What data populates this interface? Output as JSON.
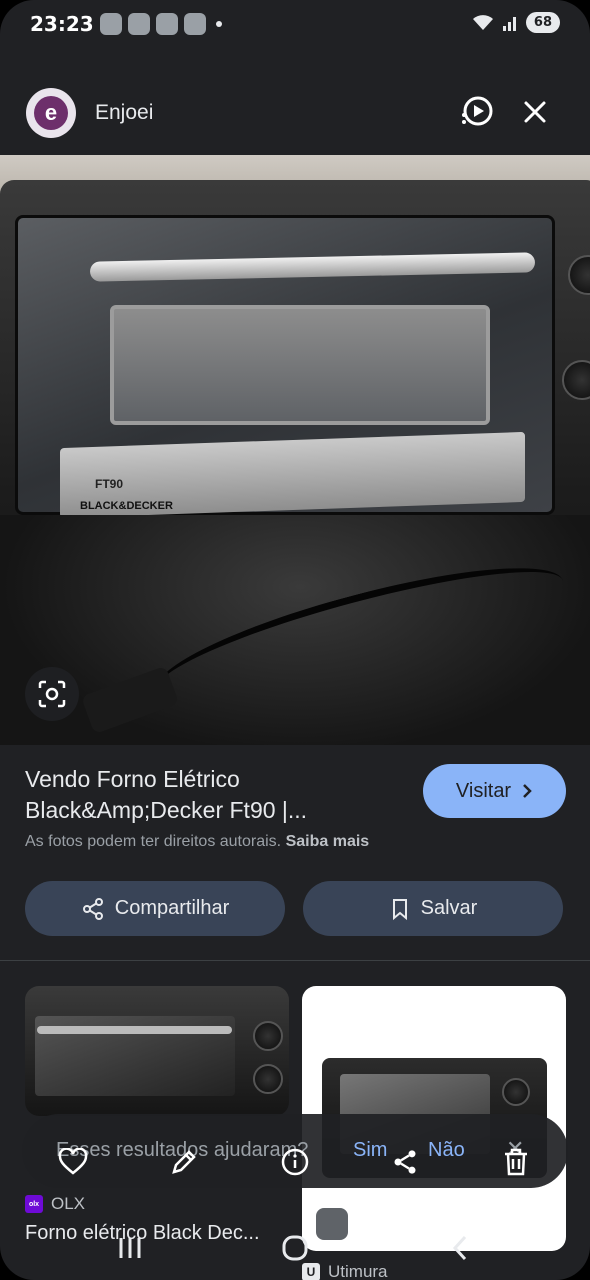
{
  "status_bar": {
    "time": "23:23",
    "battery": "68"
  },
  "header": {
    "site_name": "Enjoei",
    "favicon_letter": "e"
  },
  "result": {
    "title": "Vendo Forno Elétrico Black&Amp;Decker Ft90 |...",
    "visit_label": "Visitar",
    "copyright_text": "As fotos podem ter direitos autorais.",
    "learn_more": "Saiba mais",
    "share_label": "Compartilhar",
    "save_label": "Salvar"
  },
  "oven_image": {
    "model": "FT90",
    "brand": "BLACK&DECKER"
  },
  "related": [
    {
      "source": "OLX",
      "title": "Forno elétrico Black Dec..."
    },
    {
      "source": "Utimura"
    }
  ],
  "feedback": {
    "question": "Esses resultados ajudaram?",
    "yes": "Sim",
    "no": "Não",
    "close": "✕"
  },
  "icons": {
    "overlay": [
      "heart-icon",
      "pencil-icon",
      "info-icon",
      "share-icon",
      "trash-icon"
    ],
    "nav": [
      "recents-icon",
      "home-icon",
      "back-icon"
    ]
  },
  "colors": {
    "background": "#202124",
    "accent": "#8ab4f8",
    "button_bg": "#394457",
    "text": "#e8eaed",
    "muted": "#9aa0a6",
    "site_brand": "#6d2f6b",
    "olx": "#6e0ad6"
  }
}
